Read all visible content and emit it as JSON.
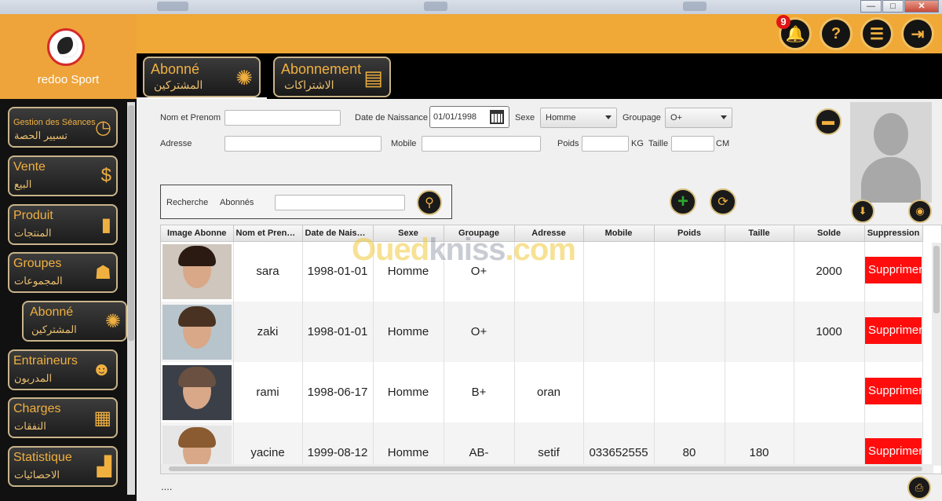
{
  "window": {
    "minimize": "—",
    "restore": "□",
    "close": "✕"
  },
  "app": {
    "name": "redoo Sport"
  },
  "header": {
    "notifications_count": "9",
    "icons": [
      "bell-icon",
      "help-icon",
      "report-icon",
      "logout-icon"
    ]
  },
  "top_tabs": [
    {
      "fr": "Abonné",
      "ar": "المشتركين",
      "icon": "people-icon",
      "active": true
    },
    {
      "fr": "Abonnement",
      "ar": "الاشتراكات",
      "icon": "card-icon",
      "active": false
    }
  ],
  "sidebar": {
    "items": [
      {
        "fr": "Gestion des Séances",
        "ar": "تسيير الحصة",
        "icon": "clock-icon"
      },
      {
        "fr": "Vente",
        "ar": "البيع",
        "icon": "tag-icon"
      },
      {
        "fr": "Produit",
        "ar": "المنتجات",
        "icon": "bottle-icon"
      },
      {
        "fr": "Groupes",
        "ar": "المجموعات",
        "icon": "group-icon"
      },
      {
        "fr": "Abonné",
        "ar": "المشتركين",
        "icon": "people-icon"
      },
      {
        "fr": "Entraineurs",
        "ar": "المدربون",
        "icon": "coach-icon"
      },
      {
        "fr": "Charges",
        "ar": "النفقات",
        "icon": "bill-icon"
      },
      {
        "fr": "Statistique",
        "ar": "الاحصائيات",
        "icon": "chart-icon"
      }
    ]
  },
  "form": {
    "nom_label": "Nom et Prenom",
    "nom_value": "",
    "naissance_label": "Date de Naissance",
    "naissance_value": "01/01/1998",
    "sexe_label": "Sexe",
    "sexe_value": "Homme",
    "groupage_label": "Groupage",
    "groupage_value": "O+",
    "adresse_label": "Adresse",
    "adresse_value": "",
    "mobile_label": "Mobile",
    "mobile_value": "",
    "poids_label": "Poids",
    "poids_value": "",
    "poids_unit": "KG",
    "taille_label": "Taille",
    "taille_value": "",
    "taille_unit": "CM"
  },
  "search": {
    "label1": "Recherche",
    "label2": "Abonnés",
    "value": ""
  },
  "table": {
    "columns": [
      "Image Abonne",
      "Nom et Prenom",
      "Date de Naissance",
      "Sexe",
      "Groupage",
      "Adresse",
      "Mobile",
      "Poids",
      "Taille",
      "Solde",
      "Suppression"
    ],
    "rows": [
      {
        "nom": "sara",
        "date": "1998-01-01",
        "sexe": "Homme",
        "groupage": "O+",
        "adresse": "",
        "mobile": "",
        "poids": "",
        "taille": "",
        "solde": "2000",
        "suppr": "Supprimer"
      },
      {
        "nom": "zaki",
        "date": "1998-01-01",
        "sexe": "Homme",
        "groupage": "O+",
        "adresse": "",
        "mobile": "",
        "poids": "",
        "taille": "",
        "solde": "1000",
        "suppr": "Supprimer"
      },
      {
        "nom": "rami",
        "date": "1998-06-17",
        "sexe": "Homme",
        "groupage": "B+",
        "adresse": "oran",
        "mobile": "",
        "poids": "",
        "taille": "",
        "solde": "",
        "suppr": "Supprimer"
      },
      {
        "nom": "yacine",
        "date": "1999-08-12",
        "sexe": "Homme",
        "groupage": "AB-",
        "adresse": "setif",
        "mobile": "033652555",
        "poids": "80",
        "taille": "180",
        "solde": "",
        "suppr": "Supprimer"
      }
    ]
  },
  "footer": {
    "status": "...."
  },
  "watermark": {
    "part1": "Oued",
    "part2": "kniss",
    "part3": ".com"
  },
  "colors": {
    "accent": "#f0a836",
    "sidebar": "#111111",
    "danger": "#ff0d0d"
  }
}
